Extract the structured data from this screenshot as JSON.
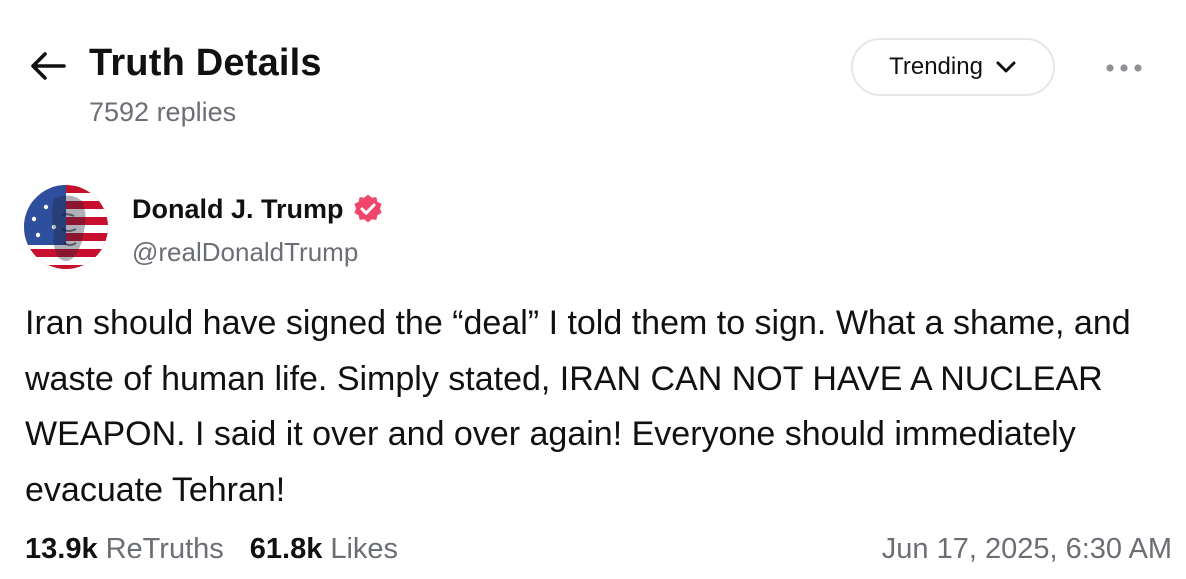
{
  "header": {
    "back_icon": "arrow-left-icon",
    "title": "Truth Details",
    "replies": "7592 replies",
    "sort": {
      "selected": "Trending",
      "icon": "chevron-down-icon"
    },
    "more_icon": "more-horizontal-icon"
  },
  "post": {
    "author": {
      "name": "Donald J. Trump",
      "handle": "@realDonaldTrump",
      "verified_icon": "verified-badge-icon",
      "verified_color": "#f0466c"
    },
    "body": "Iran should have signed the “deal” I told them to sign. What a shame, and waste of human life. Simply stated, IRAN CAN NOT HAVE A NUCLEAR WEAPON. I said it over and over again! Everyone should immediately evacuate Tehran!",
    "stats": {
      "retruths_count": "13.9k",
      "retruths_label": "ReTruths",
      "likes_count": "61.8k",
      "likes_label": "Likes"
    },
    "timestamp": "Jun 17, 2025, 6:30 AM"
  },
  "colors": {
    "text_primary": "#111111",
    "text_secondary": "#6b6e74",
    "border": "#e6e6e9",
    "verified": "#f0466c"
  }
}
